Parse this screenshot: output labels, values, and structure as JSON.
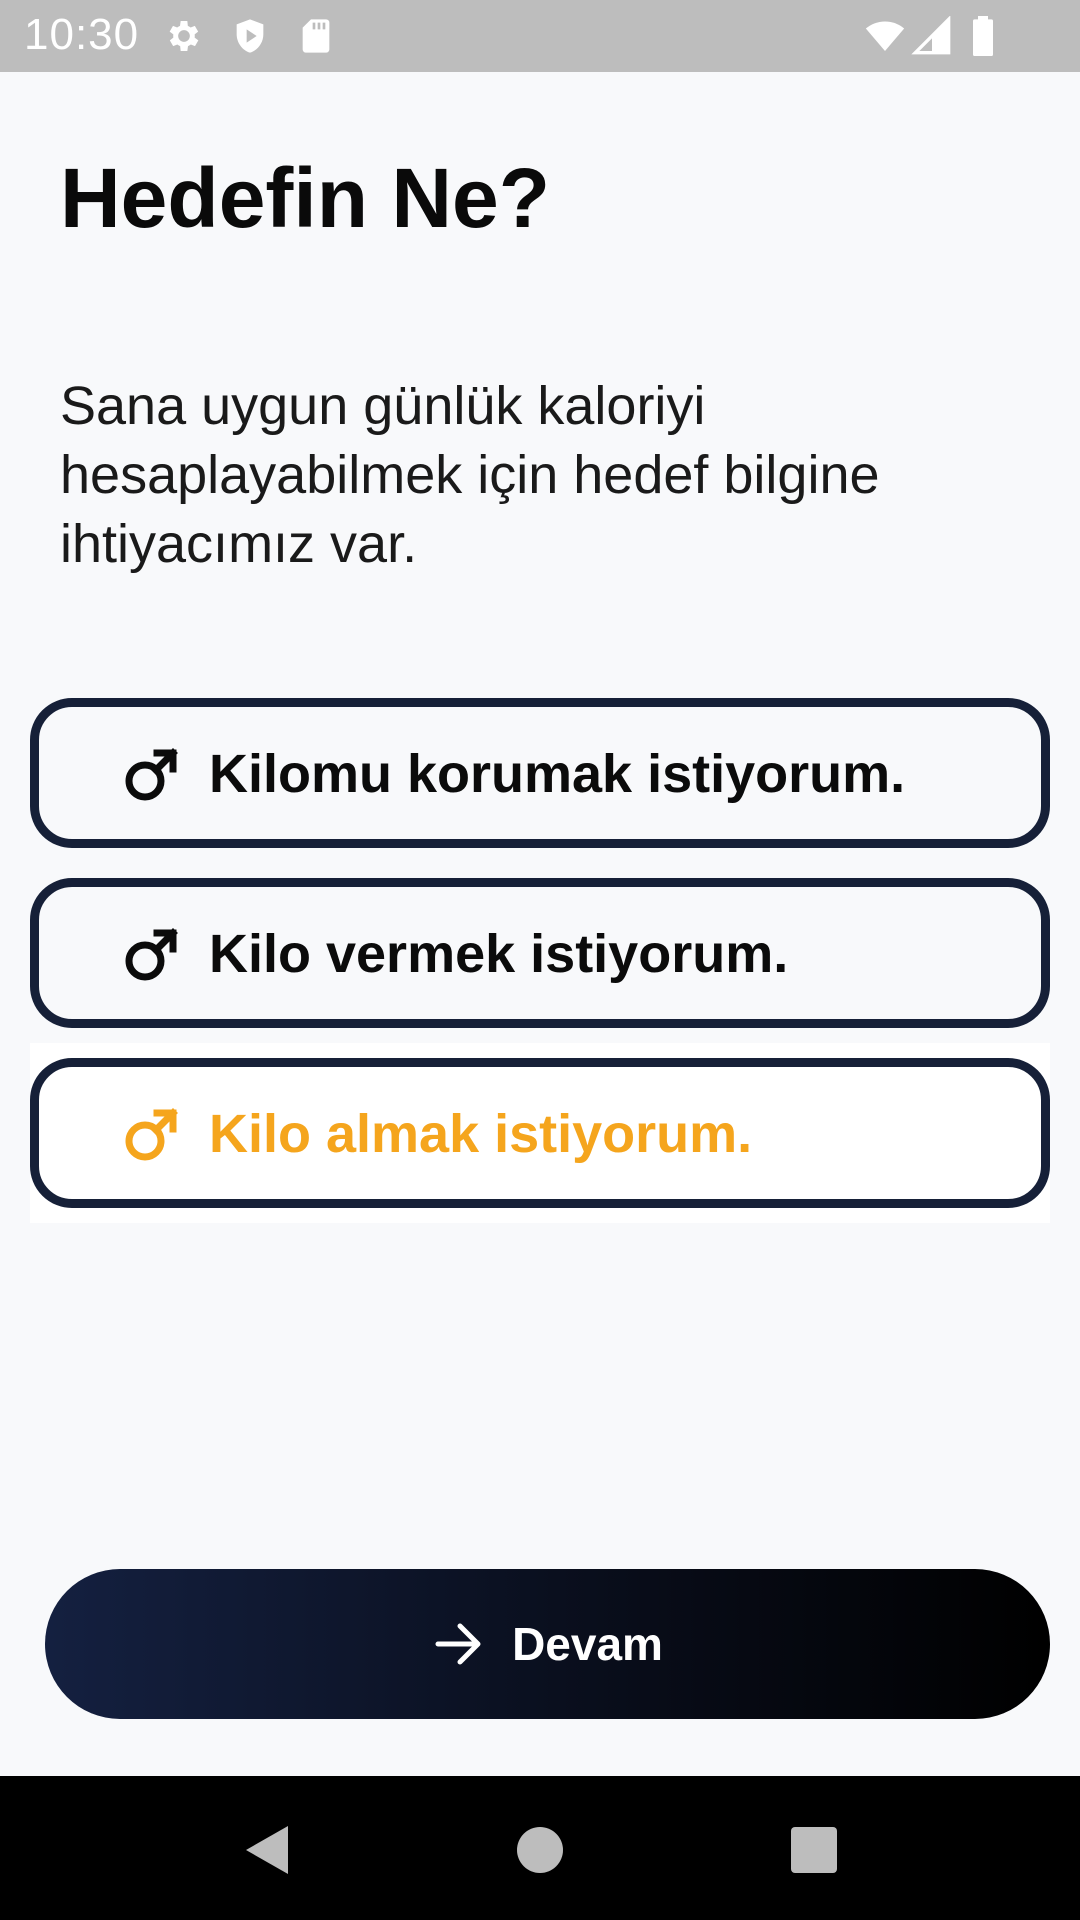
{
  "status_bar": {
    "time": "10:30",
    "icons": [
      "gear-icon",
      "shield-icon",
      "sd-card-icon",
      "wifi-icon",
      "signal-icon",
      "battery-icon"
    ]
  },
  "page": {
    "title": "Hedefin Ne?",
    "description": "Sana uygun günlük kaloriyi hesaplayabilmek için hedef bilgine ihtiyacımız var."
  },
  "options": [
    {
      "label": "Kilomu korumak istiyorum.",
      "icon": "male-symbol-icon",
      "selected": false
    },
    {
      "label": "Kilo vermek istiyorum.",
      "icon": "male-symbol-icon",
      "selected": false
    },
    {
      "label": "Kilo almak istiyorum.",
      "icon": "male-symbol-icon",
      "selected": true
    }
  ],
  "continue_button": {
    "label": "Devam",
    "icon": "arrow-right-icon"
  },
  "nav_bar": {
    "buttons": [
      "back-icon",
      "home-icon",
      "recents-icon"
    ]
  },
  "colors": {
    "background": "#f8f9fb",
    "option_border": "#162038",
    "selected_accent": "#f5a51d",
    "button_start": "#142040",
    "button_end": "#000000"
  }
}
